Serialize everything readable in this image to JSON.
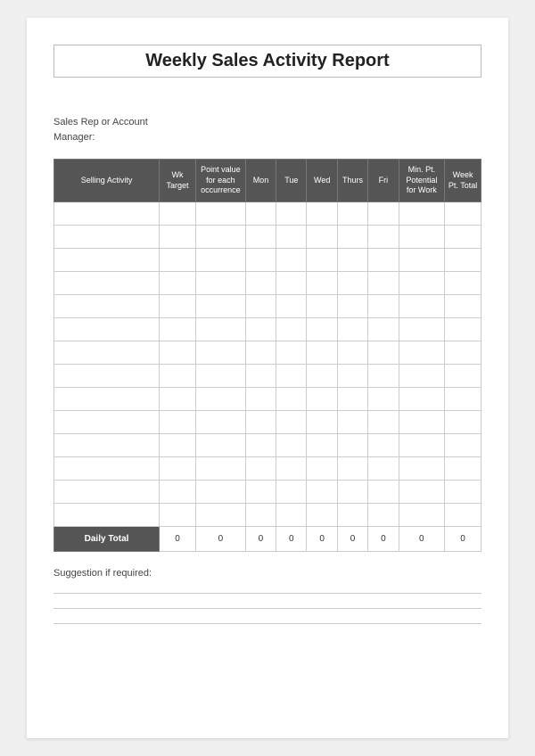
{
  "title": "Weekly Sales Activity Report",
  "fields": {
    "rep_label": "Sales Rep or Account\nManager:"
  },
  "table": {
    "headers": [
      {
        "label": "Selling Activity",
        "class": "col-activity"
      },
      {
        "label": "Wk Target",
        "class": "col-wk"
      },
      {
        "label": "Point value for each occurrence",
        "class": "col-point"
      },
      {
        "label": "Mon",
        "class": "col-day"
      },
      {
        "label": "Tue",
        "class": "col-day"
      },
      {
        "label": "Wed",
        "class": "col-day"
      },
      {
        "label": "Thurs",
        "class": "col-day"
      },
      {
        "label": "Fri",
        "class": "col-day"
      },
      {
        "label": "Min. Pt. Potential for Work",
        "class": "col-minpt"
      },
      {
        "label": "Week Pt. Total",
        "class": "col-weekpt"
      }
    ],
    "body_rows": 14,
    "footer": {
      "label": "Daily Total",
      "values": [
        "0",
        "0",
        "0",
        "0",
        "0",
        "0",
        "0",
        "0",
        "0"
      ]
    }
  },
  "suggestion": {
    "label": "Suggestion if required:",
    "lines": 3
  }
}
